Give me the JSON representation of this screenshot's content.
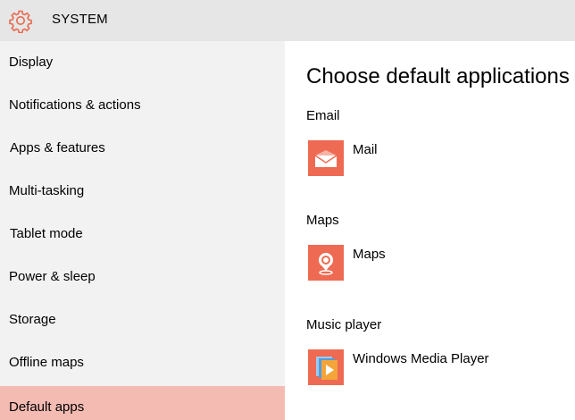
{
  "header": {
    "title": "SYSTEM",
    "icon": "gear-icon",
    "icon_color": "#e9694f"
  },
  "sidebar": {
    "items": [
      {
        "label": "Display"
      },
      {
        "label": "Notifications & actions"
      },
      {
        "label": "Apps & features"
      },
      {
        "label": "Multi-tasking"
      },
      {
        "label": "Tablet mode"
      },
      {
        "label": "Power & sleep"
      },
      {
        "label": "Storage"
      },
      {
        "label": "Offline maps"
      },
      {
        "label": "Default apps",
        "selected": true
      }
    ],
    "selected_color": "#f4bbb3"
  },
  "main": {
    "title": "Choose default applications",
    "sections": [
      {
        "label": "Email",
        "app": "Mail",
        "icon": "mail-icon"
      },
      {
        "label": "Maps",
        "app": "Maps",
        "icon": "maps-icon"
      },
      {
        "label": "Music player",
        "app": "Windows Media Player",
        "icon": "media-player-icon"
      }
    ],
    "tile_color": "#ee6a52"
  }
}
